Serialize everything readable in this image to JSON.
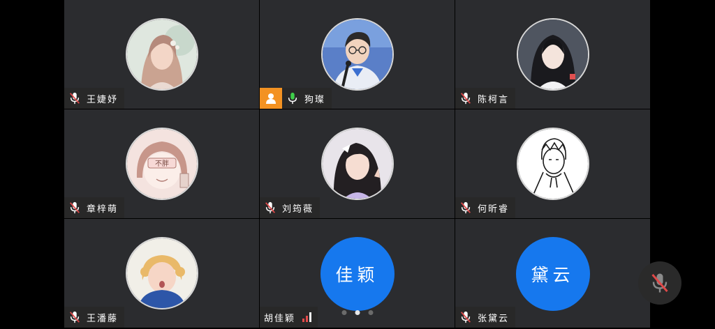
{
  "participants": [
    {
      "name": "王婕妤",
      "mic": "muted"
    },
    {
      "name": "狗璨",
      "mic": "active",
      "host": true
    },
    {
      "name": "陈柯言",
      "mic": "muted"
    },
    {
      "name": "章梓萌",
      "mic": "muted"
    },
    {
      "name": "刘筠薇",
      "mic": "muted"
    },
    {
      "name": "何昕睿",
      "mic": "muted"
    },
    {
      "name": "王潘藤",
      "mic": "muted"
    },
    {
      "name": "胡佳颖",
      "mic": "none",
      "avatar_text": "佳颖",
      "signal": "weak"
    },
    {
      "name": "张黛云",
      "mic": "muted",
      "avatar_text": "黛云"
    }
  ],
  "avatar_sign_text": "不胖",
  "pagination": {
    "count": 3,
    "current": 2
  },
  "icons": {
    "muted_mic": "mic-muted-icon",
    "active_mic": "mic-icon",
    "host": "host-user-icon",
    "signal": "signal-bars-icon"
  },
  "colors": {
    "tile_bg": "#2b2c2f",
    "accent_blue": "#1678ee",
    "host_orange": "#f39222",
    "mic_active": "#3ecf4a",
    "mic_muted": "#e04848"
  }
}
